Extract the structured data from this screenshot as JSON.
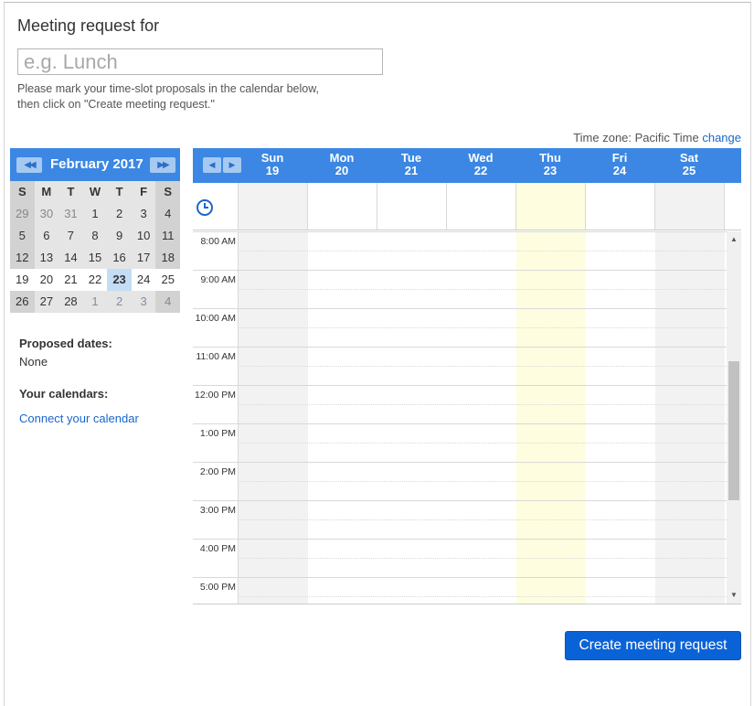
{
  "header": {
    "title": "Meeting request for",
    "name_placeholder": "e.g. Lunch",
    "instructions_line1": "Please mark your time-slot proposals in the calendar below,",
    "instructions_line2": "then click on \"Create meeting request.\""
  },
  "timezone": {
    "label": "Time zone: Pacific Time",
    "change_link": "change"
  },
  "mini_calendar": {
    "prev_label": "◀◀",
    "next_label": "▶▶",
    "month_title": "February 2017",
    "weekday_headers": [
      "S",
      "M",
      "T",
      "W",
      "T",
      "F",
      "S"
    ],
    "weeks": [
      [
        "29",
        "30",
        "31",
        "1",
        "2",
        "3",
        "4"
      ],
      [
        "5",
        "6",
        "7",
        "8",
        "9",
        "10",
        "11"
      ],
      [
        "12",
        "13",
        "14",
        "15",
        "16",
        "17",
        "18"
      ],
      [
        "19",
        "20",
        "21",
        "22",
        "23",
        "24",
        "25"
      ],
      [
        "26",
        "27",
        "28",
        "1",
        "2",
        "3",
        "4"
      ]
    ],
    "selected_day": "23"
  },
  "sidebar": {
    "proposed_label": "Proposed dates:",
    "proposed_value": "None",
    "calendars_label": "Your calendars:",
    "connect_link": "Connect your calendar"
  },
  "week_view": {
    "prev_label": "◀",
    "next_label": "▶",
    "days": [
      {
        "name": "Sun",
        "date": "19"
      },
      {
        "name": "Mon",
        "date": "20"
      },
      {
        "name": "Tue",
        "date": "21"
      },
      {
        "name": "Wed",
        "date": "22"
      },
      {
        "name": "Thu",
        "date": "23"
      },
      {
        "name": "Fri",
        "date": "24"
      },
      {
        "name": "Sat",
        "date": "25"
      }
    ],
    "highlight_day_index": 4,
    "hours": [
      "8:00 AM",
      "9:00 AM",
      "10:00 AM",
      "11:00 AM",
      "12:00 PM",
      "1:00 PM",
      "2:00 PM",
      "3:00 PM",
      "4:00 PM",
      "5:00 PM"
    ]
  },
  "actions": {
    "create_label": "Create meeting request"
  },
  "colors": {
    "accent": "#3b87e3",
    "today_highlight": "#fffde0",
    "weekend_column": "#f2f2f2",
    "link": "#1a66cc",
    "primary_button": "#0a63d6"
  },
  "icons": {
    "clock": "clock-icon"
  }
}
